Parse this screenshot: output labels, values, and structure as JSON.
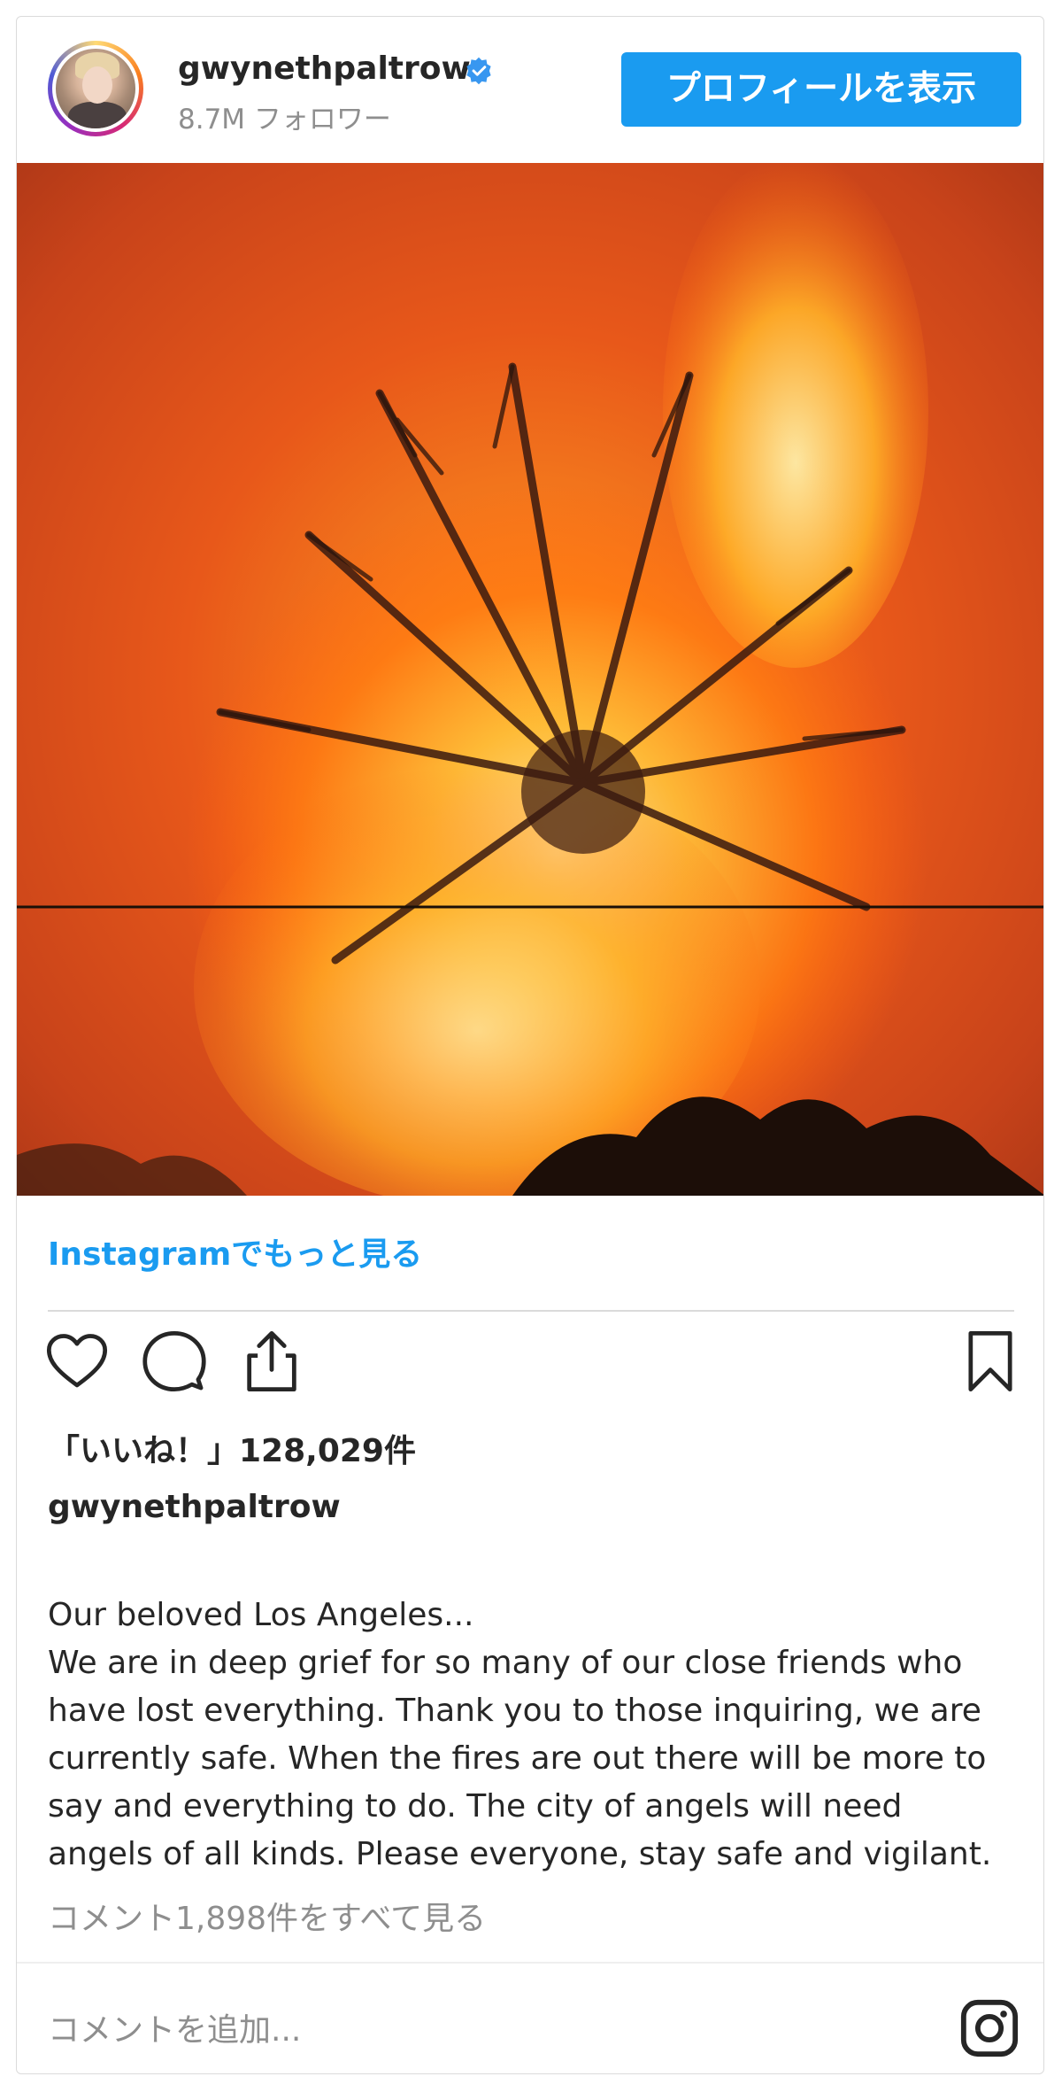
{
  "header": {
    "username": "gwynethpaltrow",
    "followers": "8.7M フォロワー",
    "profile_button": "プロフィールを表示"
  },
  "link": {
    "more_on_instagram": "Instagramでもっと見る"
  },
  "icons": {
    "like": "heart-icon",
    "comment": "comment-icon",
    "share": "share-icon",
    "save": "bookmark-icon",
    "instagram": "instagram-icon",
    "verified": "verified-badge-icon"
  },
  "stats": {
    "likes": "「いいね！」128,029件"
  },
  "caption": {
    "owner": "gwynethpaltrow",
    "text": "Our beloved Los Angeles...\nWe are in deep grief for so many of our close friends who\nhave lost everything. Thank you to those inquiring, we are\ncurrently safe. When the fires are out there will be more to\nsay and everything to do. The city of angels will need\nangels of all kinds. Please everyone, stay safe and vigilant."
  },
  "comments": {
    "view_all": "コメント1,898件をすべて見る",
    "add_placeholder": "コメントを追加..."
  },
  "colors": {
    "accent": "#1a9bf0",
    "muted": "#8e8e8e",
    "text": "#262626"
  }
}
